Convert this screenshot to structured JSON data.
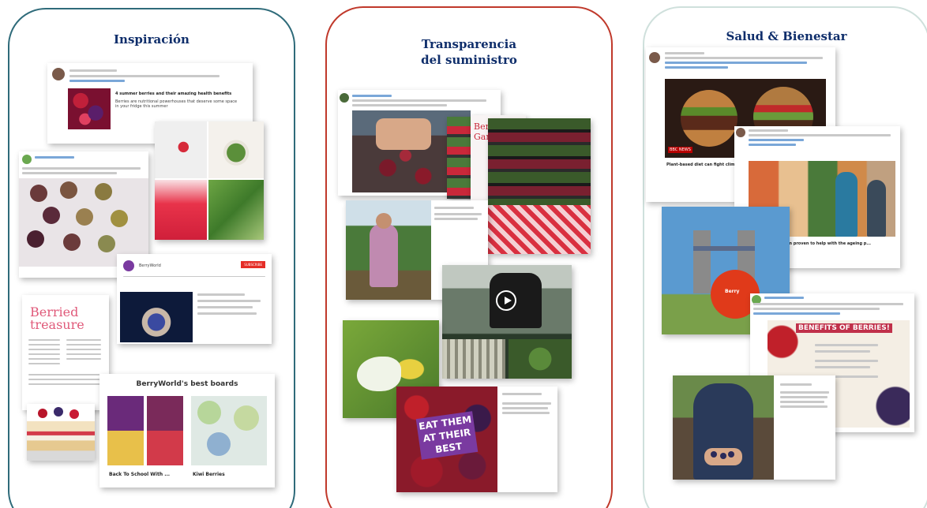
{
  "panels": [
    {
      "title": "Inspiración",
      "border": "#2f6b7a"
    },
    {
      "title": "Transparencia\ndel suministro",
      "border": "#c0392b"
    },
    {
      "title": "Salud & Bienestar",
      "border": "#cfe0dc"
    }
  ],
  "inspiracion": {
    "tweet1_headline": "4 summer berries and their amazing health benefits",
    "tweet1_body": "Berries are nutritional powerhouses that deserve some space in your fridge this summer",
    "magazine_title": "Berried treasure",
    "youtube_channel": "BerryWorld",
    "youtube_button": "SUBSCRIBE",
    "boards_title": "BerryWorld's best boards",
    "board1_label": "Back To School With ...",
    "board2_label": "Kiwi Berries"
  },
  "transparencia": {
    "berry_gardens_sign": "Berry Gardens",
    "eat_them_poster": "EAT THEM AT THEIR BEST"
  },
  "salud": {
    "news_badge": "BBC NEWS",
    "news_headline": "Plant-based diet can fight clim",
    "tweet_headline": "This fruit has been proven to help with the ageing p...",
    "benefits_title": "BENEFITS OF BERRIES!",
    "berry_sign": "Berry"
  },
  "colors": {
    "title": "#0f2e6b",
    "panel1_border": "#2f6b7a",
    "panel2_border": "#c0392b",
    "panel3_border": "#cfe0dc"
  }
}
